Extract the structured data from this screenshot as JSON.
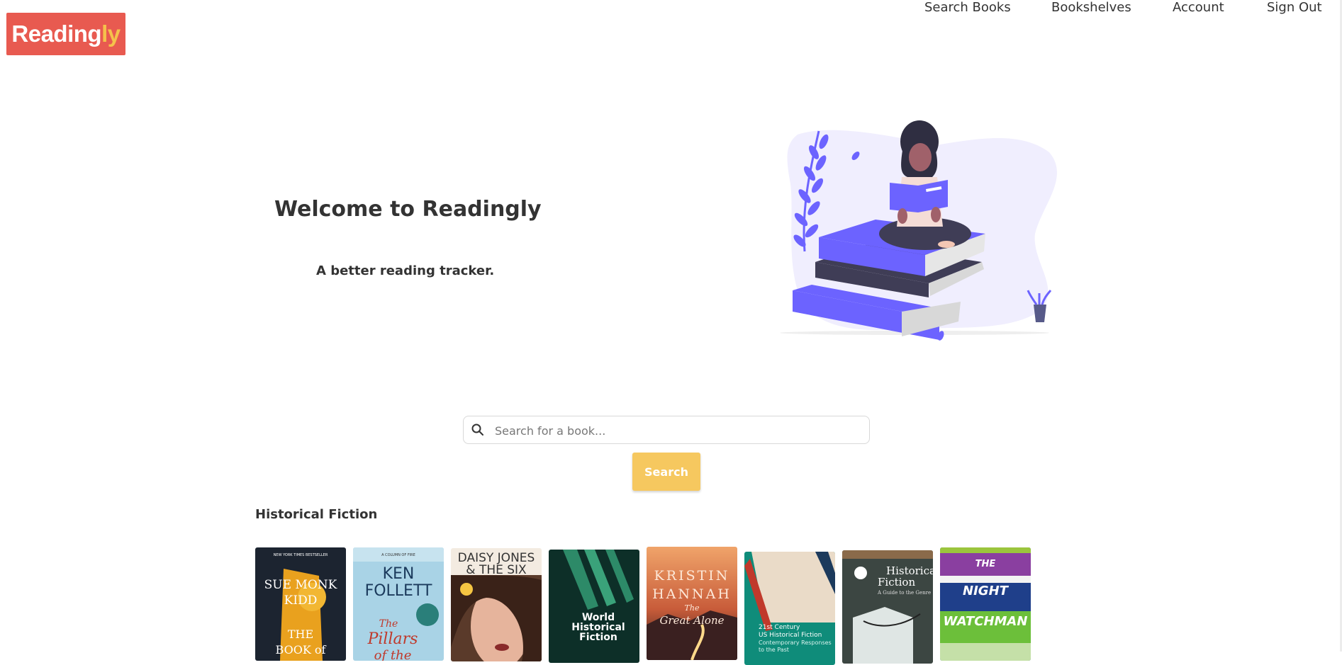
{
  "header": {
    "logo": {
      "main": "Reading",
      "accent": "ly",
      "accent_color": "#f5c24b",
      "background": "#e85a50"
    },
    "nav": [
      {
        "label": "Search Books"
      },
      {
        "label": "Bookshelves"
      },
      {
        "label": "Account"
      },
      {
        "label": "Sign Out"
      }
    ]
  },
  "hero": {
    "title": "Welcome to Readingly",
    "subtitle": "A better reading tracker."
  },
  "search": {
    "placeholder": "Search for a book...",
    "value": "",
    "button_label": "Search",
    "button_color": "#f6c85f"
  },
  "section": {
    "title": "Historical Fiction",
    "books": [
      {
        "cover_lines": [
          "NEW YORK TIMES BESTSELLER",
          "SUE MONK",
          "KIDD",
          "THE",
          "BOOK of"
        ]
      },
      {
        "cover_lines": [
          "A COLUMN OF FIRE",
          "KEN",
          "FOLLETT",
          "The",
          "Pillars",
          "of the"
        ]
      },
      {
        "cover_lines": [
          "DAISY JONES",
          "& THE SIX"
        ]
      },
      {
        "cover_lines": [
          "World",
          "Historical",
          "Fiction"
        ]
      },
      {
        "cover_lines": [
          "KRISTIN",
          "HANNAH",
          "The",
          "Great Alone"
        ]
      },
      {
        "cover_lines": [
          "21st Century",
          "US Historical Fiction",
          "Contemporary Responses",
          "to the Past"
        ]
      },
      {
        "cover_lines": [
          "Historical",
          "Fiction",
          "A Guide to the Genre"
        ]
      },
      {
        "cover_lines": [
          "THE",
          "NIGHT",
          "WATCHMAN"
        ]
      }
    ]
  },
  "icons": {
    "search": "magnifier-icon"
  },
  "colors": {
    "illustration_primary": "#6c63ff",
    "illustration_bg": "#f0eefe"
  }
}
